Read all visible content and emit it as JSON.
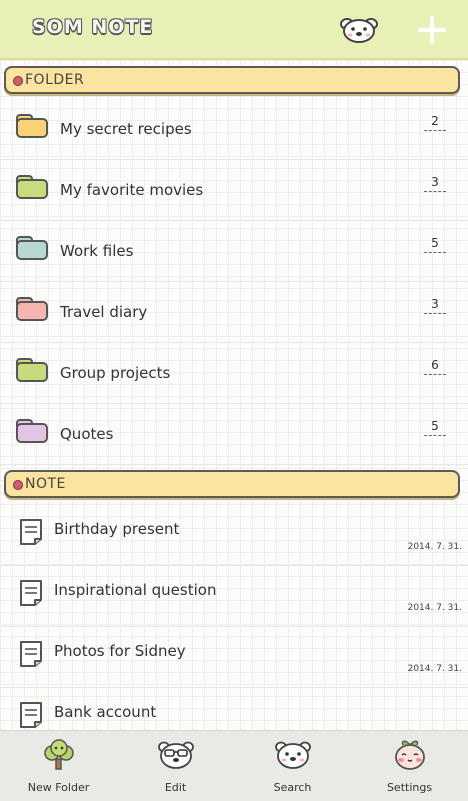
{
  "header": {
    "title": "SOM NOTE",
    "mascot_icon": "bear-face-icon",
    "add_icon": "plus-icon"
  },
  "sections": {
    "folder": "FOLDER",
    "note": "NOTE"
  },
  "colors": {
    "header_bg": "#e9f0b7",
    "section_bg": "#fbe3a0",
    "section_dot": "#d35d6e"
  },
  "folders": [
    {
      "name": "My secret recipes",
      "count": "2",
      "color": "#f8d37a"
    },
    {
      "name": "My favorite movies",
      "count": "3",
      "color": "#c6dc7e"
    },
    {
      "name": "Work files",
      "count": "5",
      "color": "#b7d7d3"
    },
    {
      "name": "Travel diary",
      "count": "3",
      "color": "#f4b6ae"
    },
    {
      "name": "Group projects",
      "count": "6",
      "color": "#c7da7c"
    },
    {
      "name": "Quotes",
      "count": "5",
      "color": "#e3c4e6"
    }
  ],
  "notes": [
    {
      "title": "Birthday present",
      "date": "2014. 7. 31."
    },
    {
      "title": "Inspirational question",
      "date": "2014. 7. 31."
    },
    {
      "title": "Photos for Sidney",
      "date": "2014. 7. 31."
    },
    {
      "title": "Bank account",
      "date": ""
    }
  ],
  "bottom_tabs": [
    {
      "label": "New Folder",
      "icon": "tree-icon"
    },
    {
      "label": "Edit",
      "icon": "bear-glasses-icon"
    },
    {
      "label": "Search",
      "icon": "bear-face-icon"
    },
    {
      "label": "Settings",
      "icon": "peach-face-icon"
    }
  ]
}
